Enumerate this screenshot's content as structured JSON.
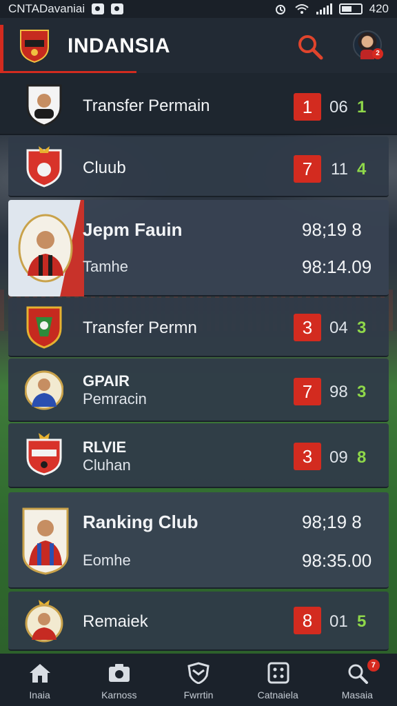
{
  "status_bar": {
    "carrier": "CNTADavaniai",
    "time": "420"
  },
  "app": {
    "title": "INDANSIA",
    "avatar_badge": "2"
  },
  "rows": [
    {
      "title": "Transfer Permain",
      "badge": "1",
      "mid": "06",
      "green": "1"
    },
    {
      "title": "Cluub",
      "badge": "7",
      "mid": "11",
      "green": "4"
    },
    {
      "title": "Jepm Fauin",
      "sub": "Tamhe",
      "num_top": "98;19 8",
      "num_bot": "98:14.09"
    },
    {
      "title": "Transfer Permn",
      "badge": "3",
      "mid": "04",
      "green": "3"
    },
    {
      "title": "GPAIR",
      "sub": "Pemracin",
      "badge": "7",
      "mid": "98",
      "green": "3"
    },
    {
      "title": "RLVIE",
      "sub": "Cluhan",
      "badge": "3",
      "mid": "09",
      "green": "8"
    },
    {
      "title": "Ranking Club",
      "sub": "Eomhe",
      "num_top": "98;19 8",
      "num_bot": "98:35.00"
    },
    {
      "title": "Remaiek",
      "badge": "8",
      "mid": "01",
      "green": "5"
    }
  ],
  "bottom_nav": [
    {
      "label": "Inaia",
      "icon": "home-icon"
    },
    {
      "label": "Karnoss",
      "icon": "camera-icon"
    },
    {
      "label": "Fwrrtin",
      "icon": "shield-icon"
    },
    {
      "label": "Catnaiela",
      "icon": "grid-icon"
    },
    {
      "label": "Masaia",
      "icon": "search-icon",
      "badge": "7"
    }
  ],
  "colors": {
    "accent_red": "#d32b1f",
    "score_green": "#8fd84a",
    "header_bg": "#222a34",
    "row_bg": "#303a48"
  }
}
